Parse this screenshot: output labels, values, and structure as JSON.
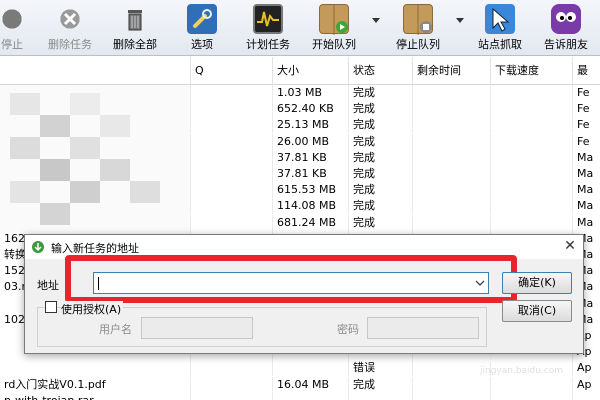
{
  "toolbar": {
    "buttons": [
      {
        "label": "停止",
        "name": "stop",
        "disabled": true
      },
      {
        "label": "删除任务",
        "name": "delete-task",
        "disabled": true
      },
      {
        "label": "删除全部",
        "name": "delete-all",
        "disabled": false
      },
      {
        "label": "选项",
        "name": "options",
        "disabled": false
      },
      {
        "label": "计划任务",
        "name": "scheduler",
        "disabled": false
      },
      {
        "label": "开始队列",
        "name": "start-queue",
        "disabled": false
      },
      {
        "label": "停止队列",
        "name": "stop-queue",
        "disabled": false
      },
      {
        "label": "站点抓取",
        "name": "site-grabber",
        "disabled": false
      },
      {
        "label": "告诉朋友",
        "name": "tell-friend",
        "disabled": false
      }
    ]
  },
  "table": {
    "columns": [
      "Q",
      "大小",
      "状态",
      "剩余时间",
      "下载速度",
      "最"
    ],
    "rows": [
      {
        "name": "",
        "size": "1.03 MB",
        "status": "完成",
        "date": "Fe"
      },
      {
        "name": "",
        "size": "652.40 KB",
        "status": "完成",
        "date": "Fe"
      },
      {
        "name": "",
        "size": "25.13 MB",
        "status": "完成",
        "date": "Fe"
      },
      {
        "name": "",
        "size": "26.00 MB",
        "status": "完成",
        "date": "Fe"
      },
      {
        "name": "",
        "size": "37.81 KB",
        "status": "完成",
        "date": "Ma"
      },
      {
        "name": "",
        "size": "37.81 KB",
        "status": "完成",
        "date": "Ma"
      },
      {
        "name": "",
        "size": "615.53 MB",
        "status": "完成",
        "date": "Ma"
      },
      {
        "name": "",
        "size": "114.08 MB",
        "status": "完成",
        "date": "Ma"
      },
      {
        "name": "",
        "size": "681.24 MB",
        "status": "完成",
        "date": "Ma"
      },
      {
        "name": "1621",
        "size": "",
        "status": "",
        "date": "Ma"
      },
      {
        "name": "转换器",
        "size": "",
        "status": "",
        "date": "Ma"
      },
      {
        "name": "15250",
        "size": "",
        "status": "",
        "date": "Ma"
      },
      {
        "name": "03.mp",
        "size": "",
        "status": "",
        "date": "Ma"
      },
      {
        "name": "",
        "size": "",
        "status": "",
        "date": "Ma"
      },
      {
        "name": "1027",
        "size": "",
        "status": "",
        "date": "Ma"
      },
      {
        "name": "",
        "size": "",
        "status": "",
        "date": "Ap"
      },
      {
        "name": "",
        "size": "",
        "status": "",
        "date": "Ap"
      },
      {
        "name": "",
        "size": "",
        "status": "错误",
        "date": "Ap"
      },
      {
        "name": "rd入门实战V0.1.pdf",
        "size": "16.04 MB",
        "status": "完成",
        "date": "Ap"
      },
      {
        "name": "n-with-trojan.rar",
        "size": "",
        "status": "",
        "date": ""
      }
    ]
  },
  "dialog": {
    "title": "输入新任务的地址",
    "address_label": "地址",
    "address_value": "",
    "ok_label": "确定(K)",
    "cancel_label": "取消(C)",
    "auth_label": "使用授权(A)",
    "username_label": "用户名",
    "password_label": "密码"
  },
  "watermark": {
    "text": "Bai 经验",
    "sub": "jingyan.baidu.com"
  },
  "colors": {
    "highlight": "#e8242d",
    "input_border": "#3c7fb1"
  }
}
